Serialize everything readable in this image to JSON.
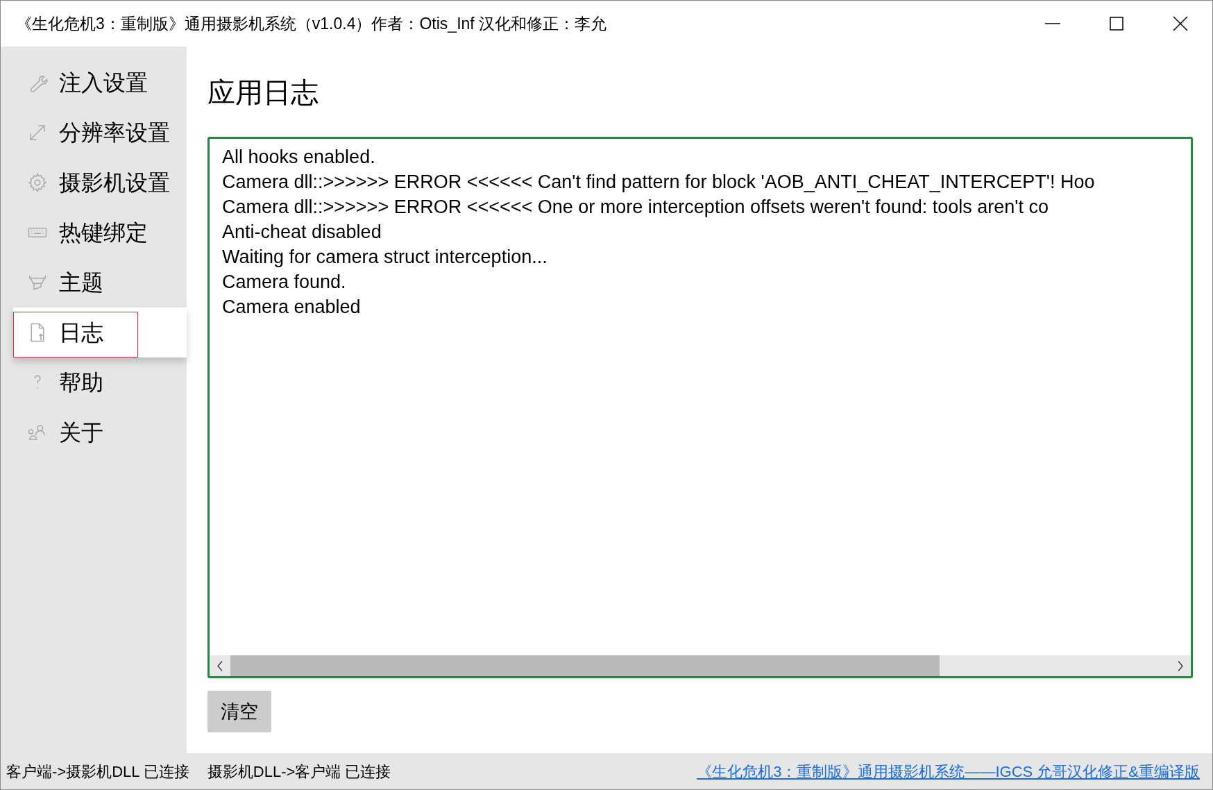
{
  "window": {
    "title": "《生化危机3：重制版》通用摄影机系统（v1.0.4）作者：Otis_Inf  汉化和修正：李允"
  },
  "sidebar": {
    "items": [
      {
        "label": "注入设置",
        "kind": "wrench",
        "selected": false
      },
      {
        "label": "分辨率设置",
        "kind": "resize",
        "selected": false
      },
      {
        "label": "摄影机设置",
        "kind": "gear",
        "selected": false
      },
      {
        "label": "热键绑定",
        "kind": "keyboard",
        "selected": false
      },
      {
        "label": "主题",
        "kind": "brush",
        "selected": false
      },
      {
        "label": "日志",
        "kind": "document",
        "selected": true
      },
      {
        "label": "帮助",
        "kind": "question",
        "selected": false
      },
      {
        "label": "关于",
        "kind": "people",
        "selected": false
      }
    ]
  },
  "page": {
    "title": "应用日志",
    "log_lines": [
      "All hooks enabled.",
      "Camera dll::>>>>>> ERROR <<<<<< Can't find pattern for block 'AOB_ANTI_CHEAT_INTERCEPT'! Hoo",
      "Camera dll::>>>>>> ERROR <<<<<< One or more interception offsets weren't found: tools aren't co",
      "Anti-cheat disabled",
      "Waiting for camera struct interception...",
      "Camera found.",
      "Camera enabled"
    ],
    "clear_button": "清空"
  },
  "status_bar": {
    "items": [
      "客户端->摄影机DLL 已连接",
      "摄影机DLL->客户端 已连接"
    ],
    "link": "《生化危机3：重制版》通用摄影机系统——IGCS 允哥汉化修正&重编译版"
  }
}
